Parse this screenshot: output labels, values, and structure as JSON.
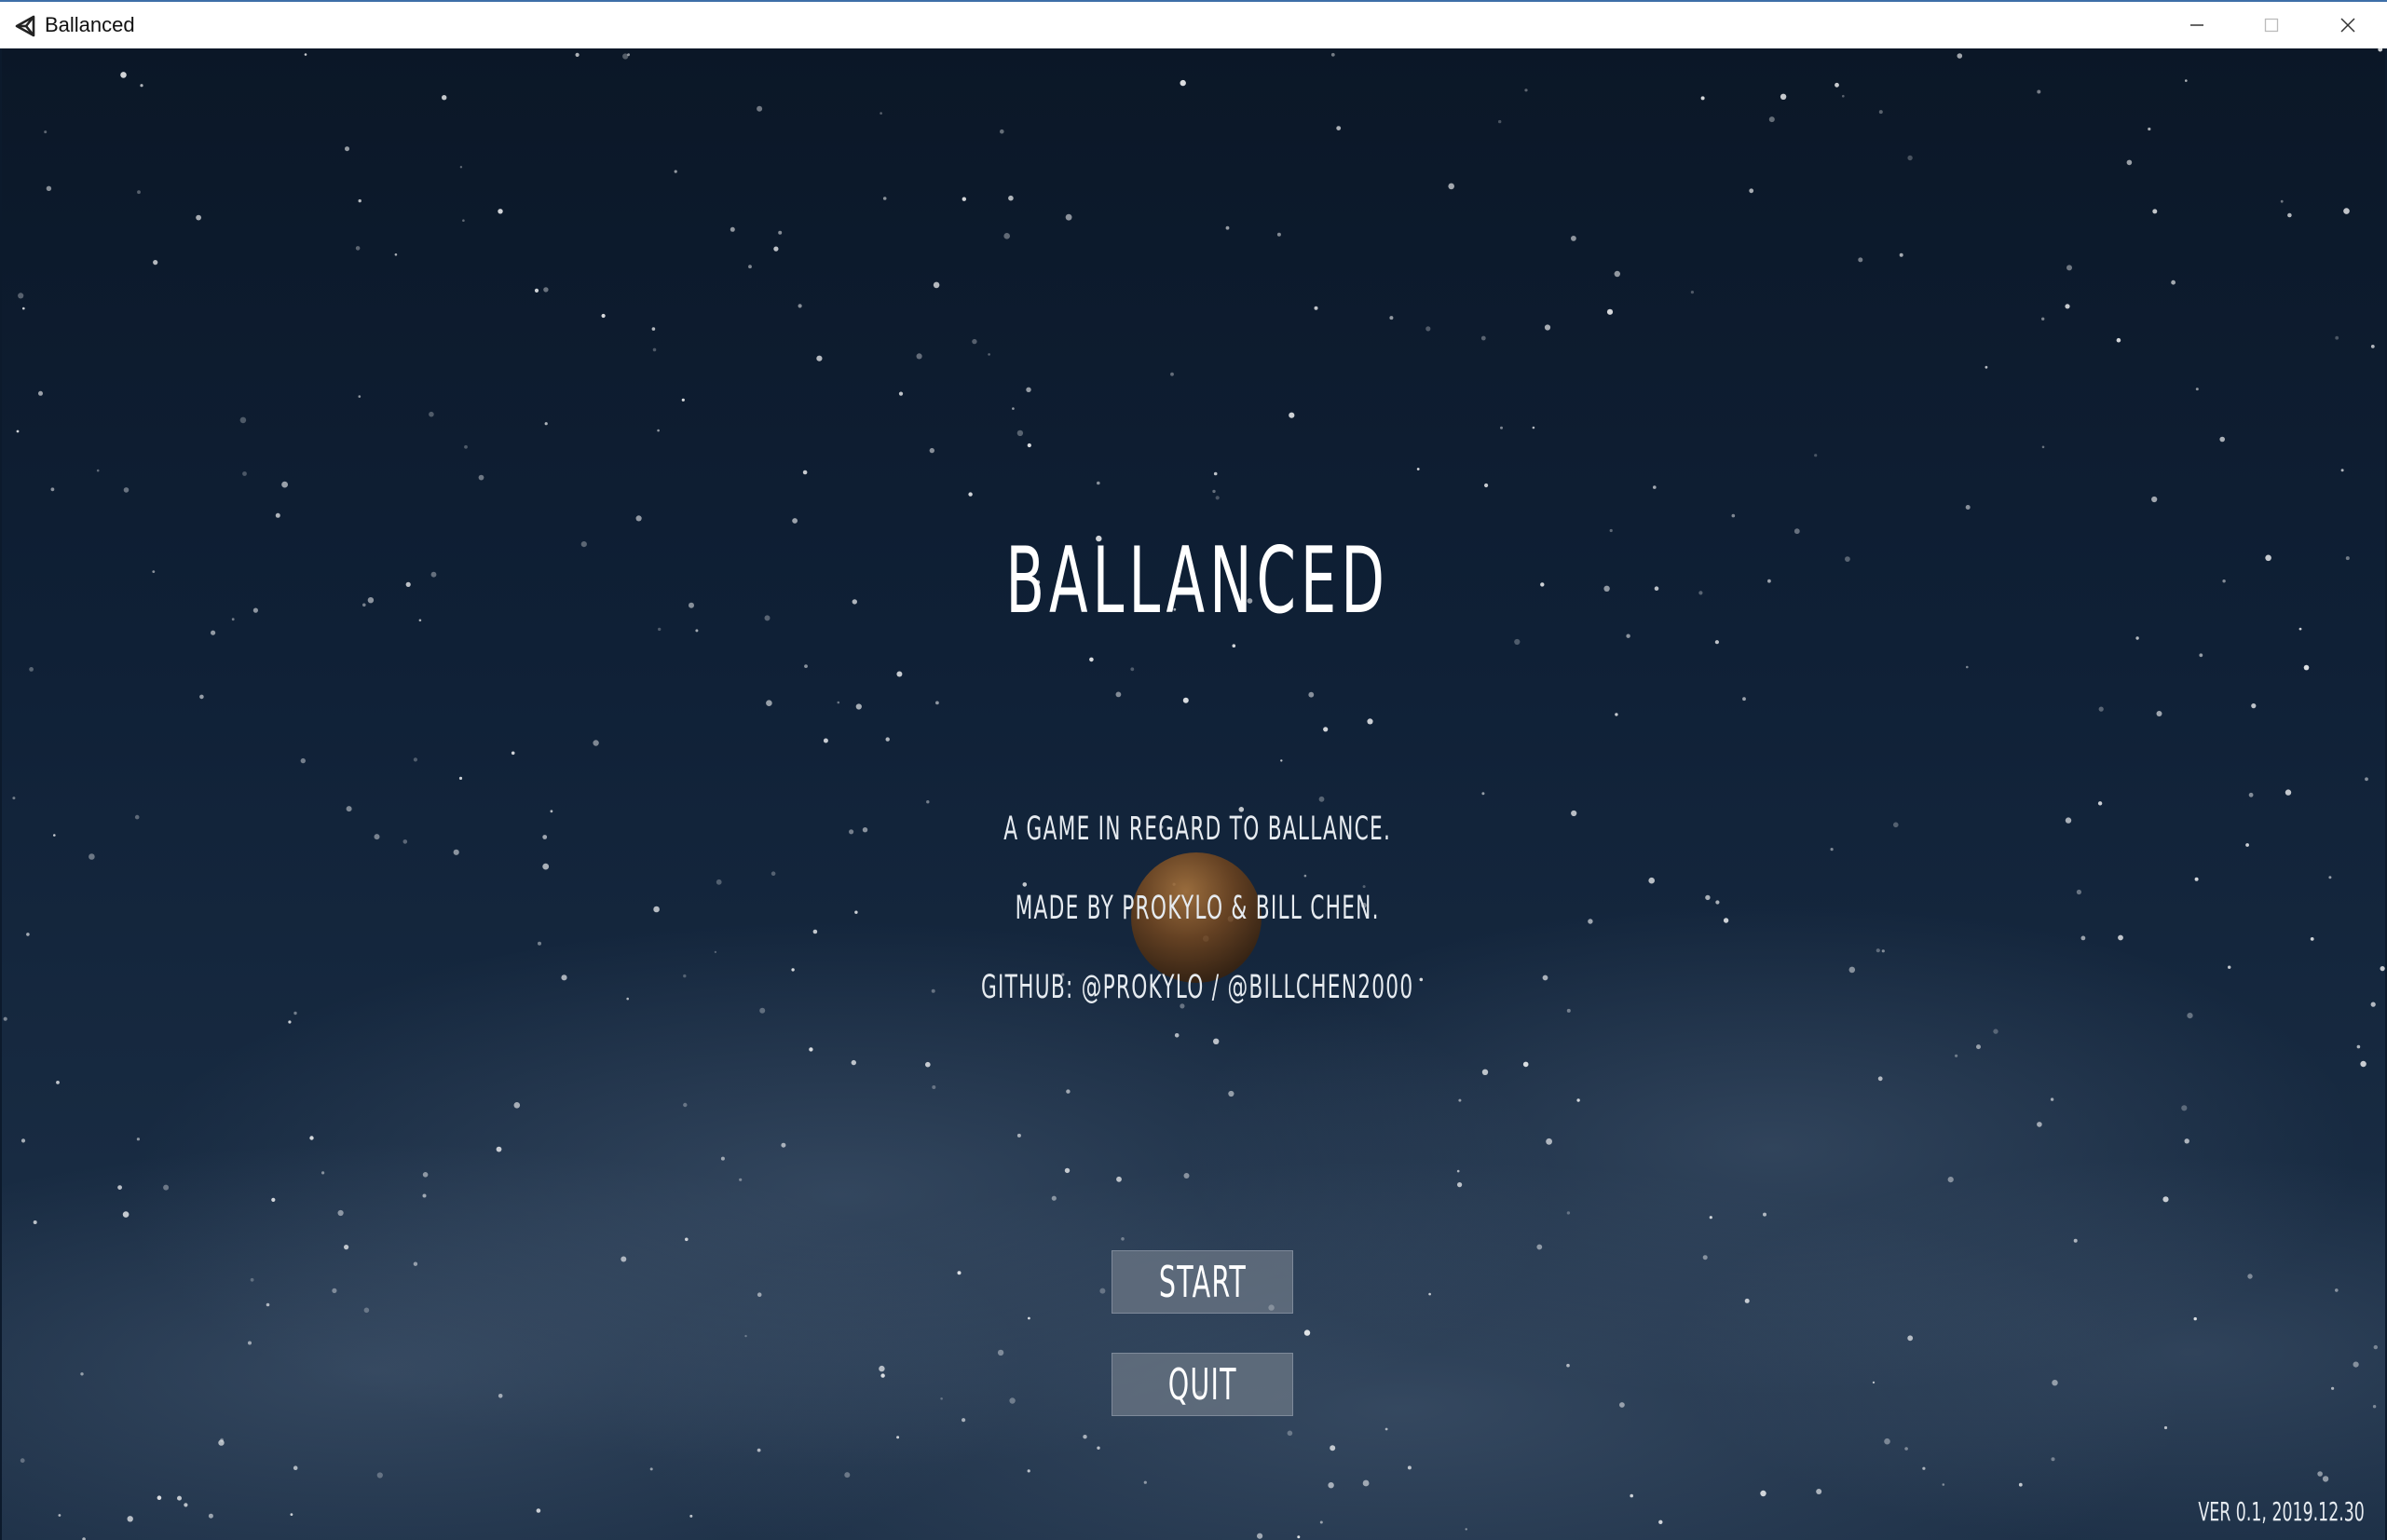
{
  "window": {
    "title": "Ballanced",
    "icon": "unity-icon",
    "controls": [
      "minimize-icon",
      "maximize-icon",
      "close-icon"
    ]
  },
  "game": {
    "title": "BALLANCED",
    "info_lines": [
      "A GAME IN REGARD TO BALLANCE.",
      "MADE BY PROKYLO & BILL CHEN.",
      "GITHUB: @PROKYLO / @BILLCHEN2000"
    ],
    "menu": {
      "start_label": "START",
      "quit_label": "QUIT"
    },
    "version": "VER 0.1, 2019.12.30"
  },
  "colors": {
    "sky": "#0f2036",
    "button": "#6e7887",
    "text": "#ffffff",
    "ball": "#6d4420"
  }
}
